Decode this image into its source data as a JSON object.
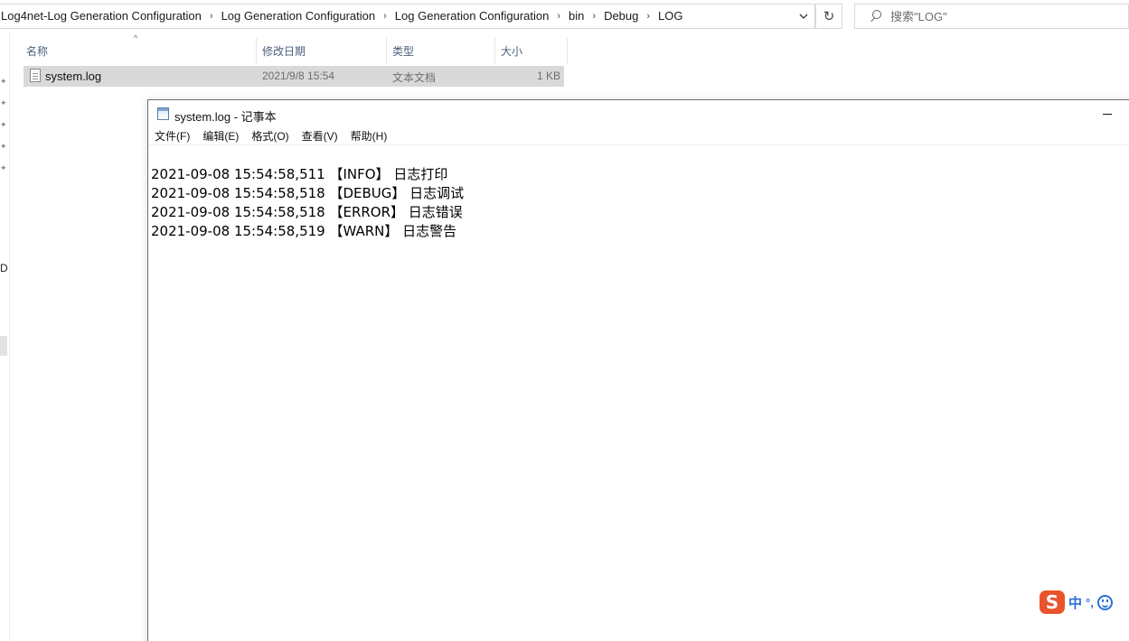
{
  "explorer": {
    "breadcrumbs": [
      "Log4net-Log Generation Configuration",
      "Log Generation Configuration",
      "Log Generation Configuration",
      "bin",
      "Debug",
      "LOG"
    ],
    "search_placeholder": "搜索\"LOG\"",
    "nav_letter": "D",
    "columns": {
      "name": "名称",
      "date": "修改日期",
      "type": "类型",
      "size": "大小"
    },
    "files": [
      {
        "name": "system.log",
        "modified": "2021/9/8 15:54",
        "type": "文本文档",
        "size": "1 KB",
        "selected": true
      }
    ]
  },
  "notepad": {
    "title": "system.log - 记事本",
    "menu": [
      "文件(F)",
      "编辑(E)",
      "格式(O)",
      "查看(V)",
      "帮助(H)"
    ],
    "lines": [
      "2021-09-08 15:54:58,511 【INFO】 日志打印",
      "2021-09-08 15:54:58,518 【DEBUG】 日志调试",
      "2021-09-08 15:54:58,518 【ERROR】 日志错误",
      "2021-09-08 15:54:58,519 【WARN】 日志警告"
    ]
  },
  "ime": {
    "logo": "S",
    "mode": "中",
    "punct": "°,",
    "logo_color": "#e9542c",
    "accent_color": "#2b6fd4"
  }
}
